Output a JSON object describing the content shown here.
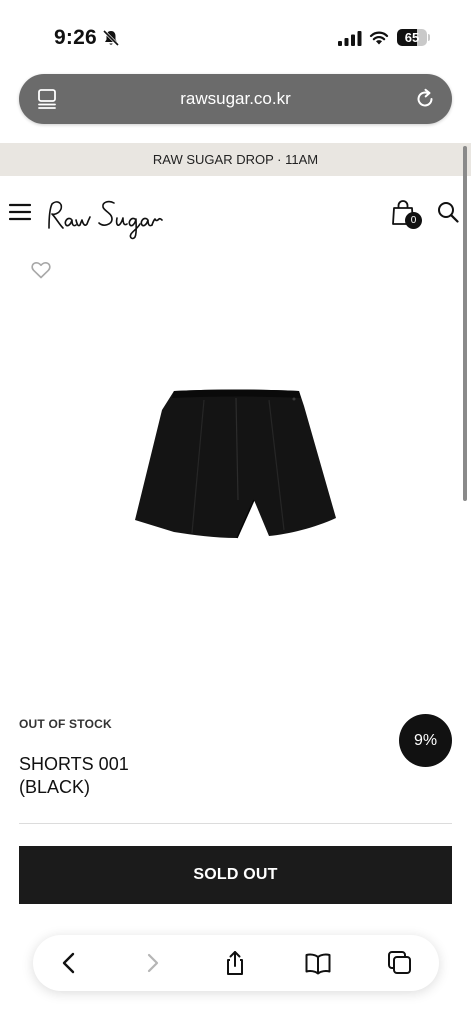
{
  "status_bar": {
    "time": "9:26",
    "battery_level": "65",
    "battery_fraction": 0.65
  },
  "browser": {
    "url": "rawsugar.co.kr"
  },
  "announcement": {
    "text": "RAW SUGAR DROP · 11AM"
  },
  "header": {
    "logo_text": "Raw Sugar",
    "cart_count": "0"
  },
  "product": {
    "stock_status": "OUT OF STOCK",
    "name_line1": "SHORTS 001",
    "name_line2": "(BLACK)",
    "discount": "9%",
    "button_label": "SOLD OUT"
  },
  "colors": {
    "accent": "#1b1b1b",
    "announcement_bg": "#e9e6e1",
    "address_bar_bg": "#6b6b6b"
  }
}
